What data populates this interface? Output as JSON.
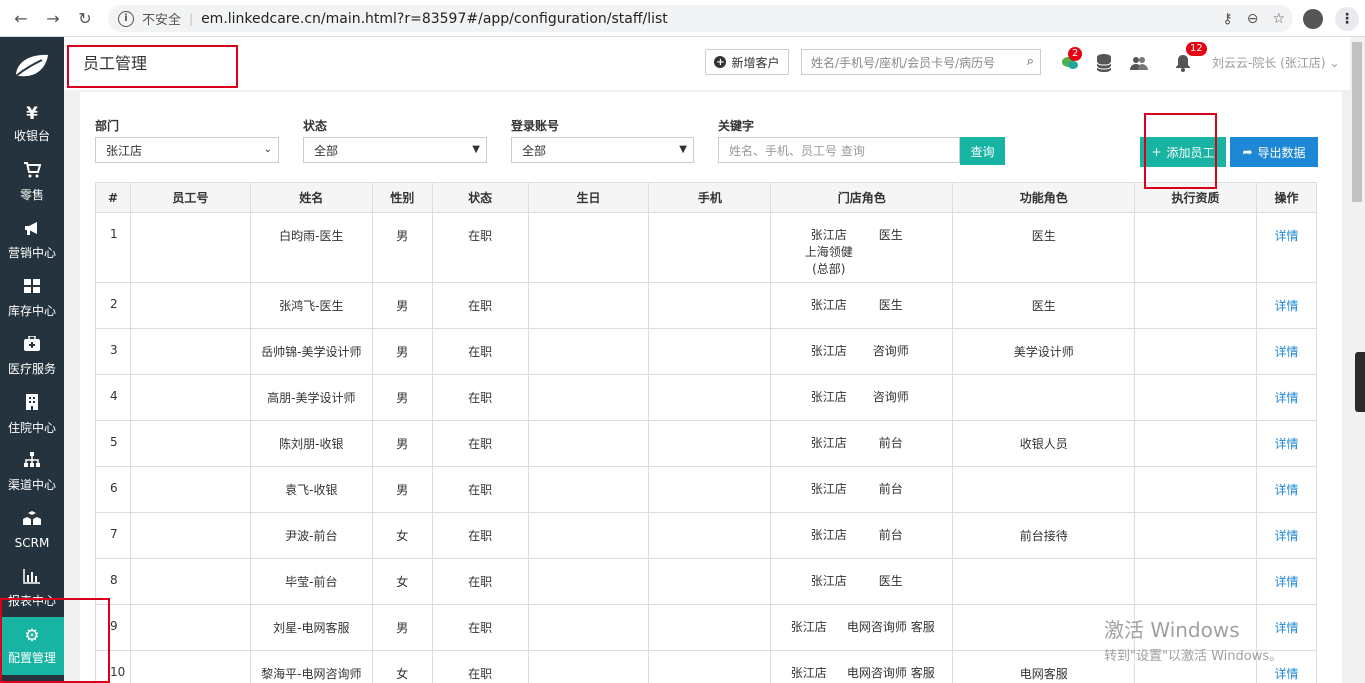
{
  "browser": {
    "insecure": "不安全",
    "url": "em.linkedcare.cn/main.html?r=83597#/app/configuration/staff/list"
  },
  "sidebar": {
    "items": [
      {
        "label": "收银台",
        "icon": "¥"
      },
      {
        "label": "零售",
        "icon": "cart-icon"
      },
      {
        "label": "营销中心",
        "icon": "megaphone-icon"
      },
      {
        "label": "库存中心",
        "icon": "grid-icon"
      },
      {
        "label": "医疗服务",
        "icon": "medkit-icon"
      },
      {
        "label": "住院中心",
        "icon": "building-icon"
      },
      {
        "label": "渠道中心",
        "icon": "hierarchy-icon"
      },
      {
        "label": "SCRM",
        "icon": "cubes-icon"
      },
      {
        "label": "报表中心",
        "icon": "bar-chart-icon"
      },
      {
        "label": "配置管理",
        "icon": "gear-icon"
      }
    ]
  },
  "topbar": {
    "title": "员工管理",
    "new_customer": "新增客户",
    "search_placeholder": "姓名/手机号/座机/会员卡号/病历号",
    "badge_wechat": "2",
    "badge_bell": "12",
    "user": "刘云云-院长 (张江店)"
  },
  "filters": {
    "dept_label": "部门",
    "dept_value": "张江店",
    "status_label": "状态",
    "status_value": "全部",
    "login_label": "登录账号",
    "login_value": "全部",
    "keyword_label": "关键字",
    "keyword_placeholder": "姓名、手机、员工号  查询",
    "query_button": "查询",
    "add_button": "添加员工",
    "export_button": "导出数据"
  },
  "table": {
    "headers": [
      "#",
      "员工号",
      "姓名",
      "性别",
      "状态",
      "生日",
      "手机",
      "门店角色",
      "功能角色",
      "执行资质",
      "操作"
    ],
    "rows": [
      {
        "no": "1",
        "name": "白昀雨-医生",
        "gender": "男",
        "status": "在职",
        "store1": "张江店",
        "role1": "医生",
        "store2": "上海领健(总部)",
        "func": "医生",
        "action": "详情"
      },
      {
        "no": "2",
        "name": "张鸿飞-医生",
        "gender": "男",
        "status": "在职",
        "store1": "张江店",
        "role1": "医生",
        "func": "医生",
        "action": "详情"
      },
      {
        "no": "3",
        "name": "岳帅锦-美学设计师",
        "gender": "男",
        "status": "在职",
        "store1": "张江店",
        "role1": "咨询师",
        "func": "美学设计师",
        "action": "详情"
      },
      {
        "no": "4",
        "name": "高朋-美学设计师",
        "gender": "男",
        "status": "在职",
        "store1": "张江店",
        "role1": "咨询师",
        "func": "",
        "action": "详情"
      },
      {
        "no": "5",
        "name": "陈刘朋-收银",
        "gender": "男",
        "status": "在职",
        "store1": "张江店",
        "role1": "前台",
        "func": "收银人员",
        "action": "详情"
      },
      {
        "no": "6",
        "name": "袁飞-收银",
        "gender": "男",
        "status": "在职",
        "store1": "张江店",
        "role1": "前台",
        "func": "",
        "action": "详情"
      },
      {
        "no": "7",
        "name": "尹波-前台",
        "gender": "女",
        "status": "在职",
        "store1": "张江店",
        "role1": "前台",
        "func": "前台接待",
        "action": "详情"
      },
      {
        "no": "8",
        "name": "毕莹-前台",
        "gender": "女",
        "status": "在职",
        "store1": "张江店",
        "role1": "医生",
        "func": "",
        "action": "详情"
      },
      {
        "no": "9",
        "name": "刘星-电网客服",
        "gender": "男",
        "status": "在职",
        "store1": "张江店",
        "role1": "电网咨询师  客服",
        "func": "",
        "action": "详情"
      },
      {
        "no": "10",
        "name": "黎海平-电网咨询师",
        "gender": "女",
        "status": "在职",
        "store1": "张江店",
        "role1": "电网咨询师  客服",
        "func": "电网客服",
        "action": "详情"
      }
    ]
  },
  "watermark": {
    "line1": "激活 Windows",
    "line2": "转到\"设置\"以激活 Windows。"
  },
  "colors": {
    "sidebar_bg": "#24333d",
    "accent": "#17b3a3",
    "export_blue": "#1e88d4",
    "highlight_red": "#d9001b",
    "badge_red": "#e60012"
  }
}
